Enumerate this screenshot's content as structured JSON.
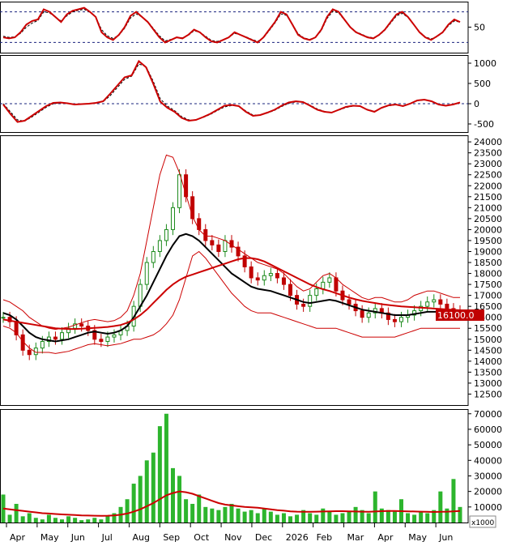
{
  "chart_data": [
    {
      "type": "line",
      "panel": "oscillator",
      "y_ticks": [
        50
      ],
      "reference_lines": [
        80,
        20
      ],
      "x_months": [
        "Apr",
        "May",
        "Jun",
        "Jul",
        "Aug",
        "Sep",
        "Oct",
        "Nov",
        "Dec",
        "2026",
        "Feb",
        "Mar",
        "Apr",
        "May",
        "Jun"
      ],
      "series": [
        {
          "color": "#cc0000",
          "values": [
            30,
            28,
            30,
            40,
            55,
            62,
            65,
            85,
            80,
            70,
            60,
            75,
            82,
            85,
            88,
            80,
            70,
            40,
            30,
            25,
            35,
            50,
            72,
            80,
            70,
            60,
            45,
            30,
            20,
            25,
            30,
            28,
            35,
            45,
            40,
            30,
            22,
            20,
            25,
            30,
            40,
            35,
            30,
            25,
            20,
            30,
            45,
            60,
            80,
            75,
            55,
            35,
            28,
            25,
            30,
            45,
            70,
            85,
            80,
            65,
            50,
            40,
            35,
            30,
            28,
            35,
            45,
            60,
            75,
            80,
            70,
            55,
            40,
            30,
            25,
            32,
            40,
            55,
            65,
            60
          ]
        },
        {
          "color": "#000000",
          "dashed": true,
          "values": [
            32,
            30,
            31,
            38,
            50,
            58,
            63,
            80,
            78,
            70,
            62,
            72,
            80,
            83,
            85,
            79,
            70,
            45,
            33,
            28,
            34,
            48,
            68,
            76,
            70,
            61,
            47,
            33,
            23,
            26,
            30,
            29,
            34,
            43,
            40,
            32,
            24,
            22,
            25,
            30,
            38,
            35,
            31,
            26,
            22,
            29,
            43,
            58,
            76,
            73,
            56,
            37,
            29,
            26,
            30,
            43,
            67,
            81,
            78,
            64,
            51,
            41,
            36,
            31,
            29,
            34,
            44,
            58,
            72,
            77,
            69,
            55,
            41,
            31,
            27,
            31,
            39,
            53,
            62,
            60
          ]
        }
      ]
    },
    {
      "type": "line",
      "panel": "macd",
      "y_ticks": [
        1000,
        500,
        0,
        -500
      ],
      "reference_lines": [
        0
      ],
      "series": [
        {
          "color": "#cc0000",
          "values": [
            -20,
            -250,
            -450,
            -420,
            -300,
            -180,
            -60,
            20,
            30,
            10,
            -20,
            -10,
            0,
            20,
            60,
            250,
            450,
            650,
            700,
            1050,
            900,
            500,
            50,
            -100,
            -200,
            -350,
            -420,
            -400,
            -330,
            -250,
            -150,
            -50,
            -30,
            -60,
            -200,
            -300,
            -280,
            -220,
            -150,
            -50,
            30,
            60,
            40,
            -50,
            -150,
            -200,
            -220,
            -150,
            -80,
            -50,
            -60,
            -150,
            -200,
            -100,
            -40,
            -20,
            -60,
            0,
            80,
            100,
            60,
            -20,
            -50,
            -20,
            30
          ]
        },
        {
          "color": "#000000",
          "dashed": true,
          "values": [
            0,
            -200,
            -400,
            -430,
            -330,
            -210,
            -90,
            0,
            20,
            10,
            -15,
            -10,
            -2,
            15,
            50,
            200,
            400,
            600,
            680,
            980,
            920,
            560,
            120,
            -60,
            -170,
            -320,
            -400,
            -400,
            -340,
            -265,
            -170,
            -80,
            -45,
            -60,
            -180,
            -280,
            -280,
            -230,
            -165,
            -70,
            10,
            45,
            40,
            -35,
            -130,
            -190,
            -215,
            -160,
            -95,
            -60,
            -60,
            -140,
            -190,
            -110,
            -50,
            -25,
            -55,
            -5,
            70,
            95,
            65,
            -10,
            -45,
            -25,
            20
          ]
        }
      ]
    },
    {
      "type": "candlestick",
      "panel": "price",
      "y_ticks": [
        24000,
        23500,
        23000,
        22500,
        22000,
        21500,
        21000,
        20500,
        20000,
        19500,
        19000,
        18500,
        18000,
        17500,
        17000,
        16500,
        16000,
        15500,
        15000,
        14500,
        14000,
        13500,
        13000,
        12500
      ],
      "ylim": [
        12000,
        24300
      ],
      "last_price_label": "16100.0",
      "x_months": [
        "Apr",
        "May",
        "Jun",
        "Jul",
        "Aug",
        "Sep",
        "Oct",
        "Nov",
        "Dec",
        "2026",
        "Feb",
        "Mar",
        "Apr",
        "May",
        "Jun"
      ],
      "close": [
        16000,
        15800,
        15200,
        14500,
        14300,
        14600,
        14900,
        15100,
        15000,
        15300,
        15500,
        15700,
        15600,
        15400,
        15000,
        14900,
        15100,
        15200,
        15400,
        15600,
        16500,
        17500,
        18500,
        19000,
        19500,
        20000,
        21000,
        22500,
        21500,
        20500,
        20000,
        19500,
        19300,
        19000,
        19500,
        19200,
        18800,
        18300,
        17800,
        17700,
        17900,
        18000,
        17800,
        17500,
        17000,
        16600,
        16500,
        17000,
        17300,
        17600,
        17800,
        17200,
        16800,
        16600,
        16300,
        16000,
        16200,
        16400,
        16200,
        15900,
        15800,
        16000,
        16100,
        16300,
        16500,
        16700,
        16800,
        16600,
        16400,
        16300,
        16100
      ],
      "overlays": [
        {
          "name": "",
          "color": "#000000",
          "values": [
            16200,
            16100,
            15900,
            15600,
            15300,
            15100,
            15000,
            14950,
            14900,
            14950,
            15000,
            15100,
            15200,
            15300,
            15350,
            15300,
            15250,
            15300,
            15400,
            15600,
            16000,
            16500,
            17000,
            17600,
            18200,
            18800,
            19300,
            19700,
            19800,
            19700,
            19500,
            19200,
            18900,
            18600,
            18300,
            18000,
            17800,
            17600,
            17400,
            17300,
            17250,
            17200,
            17100,
            17000,
            16900,
            16800,
            16700,
            16650,
            16700,
            16750,
            16800,
            16750,
            16650,
            16550,
            16450,
            16350,
            16300,
            16250,
            16200,
            16150,
            16100,
            16100,
            16100,
            16150,
            16200,
            16250,
            16250,
            16250,
            16200,
            16200,
            16200
          ]
        },
        {
          "name": "",
          "color": "#cc0000",
          "values": [
            15900,
            15850,
            15800,
            15750,
            15700,
            15650,
            15600,
            15550,
            15500,
            15480,
            15470,
            15470,
            15480,
            15500,
            15520,
            15540,
            15560,
            15600,
            15650,
            15750,
            15900,
            16100,
            16350,
            16650,
            16950,
            17250,
            17500,
            17700,
            17850,
            17950,
            18050,
            18150,
            18250,
            18350,
            18450,
            18550,
            18650,
            18700,
            18700,
            18650,
            18550,
            18400,
            18250,
            18100,
            17950,
            17800,
            17650,
            17500,
            17380,
            17280,
            17200,
            17100,
            17000,
            16900,
            16820,
            16750,
            16700,
            16650,
            16600,
            16560,
            16530,
            16500,
            16480,
            16460,
            16440,
            16420,
            16400,
            16380,
            16360,
            16340,
            16320
          ]
        },
        {
          "name": "",
          "color": "#cc0000",
          "thin": true,
          "values": [
            16800,
            16700,
            16500,
            16300,
            16000,
            15800,
            15600,
            15500,
            15450,
            15500,
            15550,
            15650,
            15750,
            15850,
            15900,
            15850,
            15800,
            15850,
            16000,
            16300,
            17000,
            18000,
            19500,
            21000,
            22500,
            23400,
            23300,
            22600,
            21600,
            20600,
            20000,
            19700,
            19700,
            19600,
            19500,
            19300,
            19100,
            18900,
            18700,
            18500,
            18400,
            18300,
            18200,
            18000,
            17700,
            17400,
            17200,
            17300,
            17600,
            17900,
            18000,
            17800,
            17500,
            17300,
            17100,
            16900,
            16800,
            16900,
            16900,
            16800,
            16700,
            16700,
            16800,
            17000,
            17100,
            17200,
            17200,
            17100,
            17000,
            16900,
            16900
          ]
        },
        {
          "name": "",
          "color": "#cc0000",
          "thin": true,
          "values": [
            15600,
            15500,
            15300,
            14900,
            14600,
            14400,
            14400,
            14400,
            14350,
            14400,
            14450,
            14550,
            14650,
            14750,
            14800,
            14750,
            14700,
            14750,
            14800,
            14900,
            15000,
            15000,
            15100,
            15200,
            15400,
            15700,
            16100,
            16800,
            17800,
            18800,
            19000,
            18700,
            18300,
            17900,
            17500,
            17100,
            16800,
            16500,
            16300,
            16200,
            16200,
            16200,
            16100,
            16000,
            15900,
            15800,
            15700,
            15600,
            15500,
            15500,
            15500,
            15500,
            15400,
            15300,
            15200,
            15100,
            15100,
            15100,
            15100,
            15100,
            15100,
            15200,
            15300,
            15400,
            15500,
            15500,
            15500,
            15500,
            15500,
            15500,
            15500
          ]
        }
      ]
    },
    {
      "type": "bar",
      "panel": "volume",
      "y_ticks": [
        70000,
        60000,
        50000,
        40000,
        30000,
        20000,
        10000
      ],
      "unit_label": "x1000",
      "ylim": [
        0,
        73000
      ],
      "values": [
        18000,
        5000,
        12000,
        4000,
        6000,
        3000,
        2000,
        5000,
        3000,
        2000,
        4000,
        3000,
        1500,
        2000,
        3000,
        2000,
        4000,
        6000,
        10000,
        15000,
        25000,
        30000,
        40000,
        45000,
        62000,
        70000,
        35000,
        30000,
        15000,
        12000,
        18000,
        10000,
        9000,
        8000,
        10000,
        12000,
        9000,
        7000,
        8000,
        6000,
        9000,
        7000,
        5000,
        6000,
        4000,
        5000,
        8000,
        6000,
        5000,
        9000,
        7000,
        5000,
        6000,
        7000,
        10000,
        8000,
        6000,
        20000,
        9000,
        8000,
        7000,
        15000,
        6000,
        5000,
        7000,
        6000,
        8000,
        20000,
        9000,
        28000,
        10000
      ],
      "overlay": {
        "name": "",
        "color": "#cc0000",
        "values": [
          9000,
          8500,
          8000,
          7500,
          7000,
          6500,
          6000,
          5800,
          5500,
          5200,
          5000,
          4800,
          4600,
          4500,
          4400,
          4300,
          4400,
          4600,
          5000,
          5800,
          7000,
          8500,
          10500,
          12500,
          15000,
          17500,
          19000,
          20000,
          19500,
          18500,
          17000,
          15500,
          14000,
          12500,
          11500,
          11000,
          10500,
          10000,
          9800,
          9500,
          9000,
          8500,
          8000,
          7600,
          7200,
          7000,
          6900,
          6900,
          7000,
          7100,
          7200,
          7300,
          7300,
          7200,
          7100,
          7000,
          6900,
          7100,
          7300,
          7400,
          7400,
          7300,
          7200,
          7100,
          7000,
          6900,
          6800,
          6900,
          7000,
          7200,
          7400
        ]
      }
    }
  ]
}
